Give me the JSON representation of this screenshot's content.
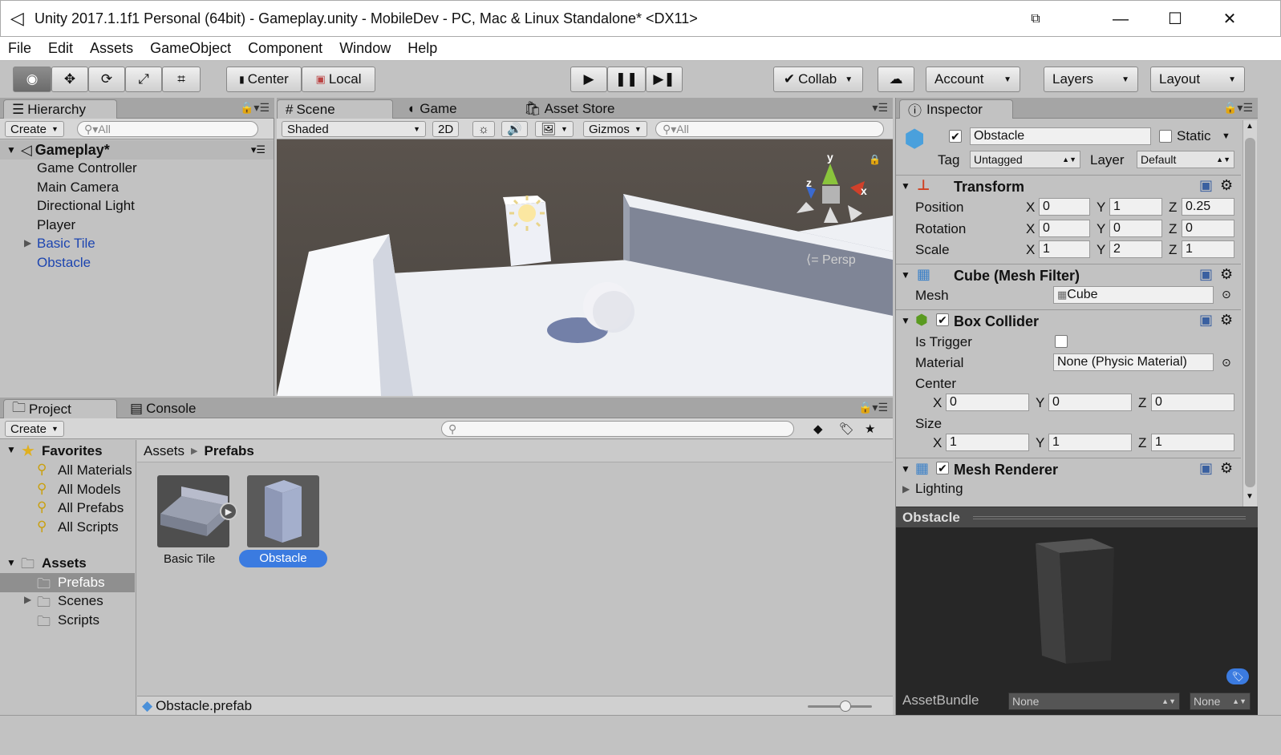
{
  "window": {
    "title": "Unity 2017.1.1f1 Personal (64bit) - Gameplay.unity - MobileDev - PC, Mac & Linux Standalone* <DX11>"
  },
  "menu": [
    "File",
    "Edit",
    "Assets",
    "GameObject",
    "Component",
    "Window",
    "Help"
  ],
  "toolbar": {
    "pivot": "Center",
    "space": "Local",
    "collab": "Collab",
    "account": "Account",
    "layers": "Layers",
    "layout": "Layout"
  },
  "hierarchy": {
    "tab": "Hierarchy",
    "create": "Create",
    "search_placeholder": "All",
    "scene_name": "Gameplay*",
    "items": [
      "Game Controller",
      "Main Camera",
      "Directional Light",
      "Player",
      "Basic Tile",
      "Obstacle"
    ]
  },
  "scene": {
    "tabs": [
      "Scene",
      "Game",
      "Asset Store"
    ],
    "shading": "Shaded",
    "mode_2d": "2D",
    "gizmos": "Gizmos",
    "search_placeholder": "All",
    "persp": "Persp",
    "gizmo_axes": {
      "y": "y",
      "x": "x",
      "z": "z"
    }
  },
  "project": {
    "tabs": [
      "Project",
      "Console"
    ],
    "create": "Create",
    "favorites_label": "Favorites",
    "favorites": [
      "All Materials",
      "All Models",
      "All Prefabs",
      "All Scripts"
    ],
    "assets_label": "Assets",
    "folders": [
      "Prefabs",
      "Scenes",
      "Scripts"
    ],
    "breadcrumb": [
      "Assets",
      "Prefabs"
    ],
    "items": [
      "Basic Tile",
      "Obstacle"
    ],
    "selected_file": "Obstacle.prefab"
  },
  "inspector": {
    "tab": "Inspector",
    "object_name": "Obstacle",
    "static_label": "Static",
    "tag_label": "Tag",
    "tag_value": "Untagged",
    "layer_label": "Layer",
    "layer_value": "Default",
    "transform": {
      "title": "Transform",
      "position_label": "Position",
      "rotation_label": "Rotation",
      "scale_label": "Scale",
      "position": {
        "x": "0",
        "y": "1",
        "z": "0.25"
      },
      "rotation": {
        "x": "0",
        "y": "0",
        "z": "0"
      },
      "scale": {
        "x": "1",
        "y": "2",
        "z": "1"
      }
    },
    "mesh_filter": {
      "title": "Cube (Mesh Filter)",
      "mesh_label": "Mesh",
      "mesh_value": "Cube"
    },
    "box_collider": {
      "title": "Box Collider",
      "is_trigger_label": "Is Trigger",
      "material_label": "Material",
      "material_value": "None (Physic Material)",
      "center_label": "Center",
      "size_label": "Size",
      "center": {
        "x": "0",
        "y": "0",
        "z": "0"
      },
      "size": {
        "x": "1",
        "y": "1",
        "z": "1"
      }
    },
    "mesh_renderer": {
      "title": "Mesh Renderer",
      "lighting_label": "Lighting"
    },
    "preview_title": "Obstacle",
    "assetbundle_label": "AssetBundle",
    "assetbundle_value": "None",
    "assetbundle_variant": "None"
  },
  "axis_letters": {
    "x": "X",
    "y": "Y",
    "z": "Z"
  }
}
